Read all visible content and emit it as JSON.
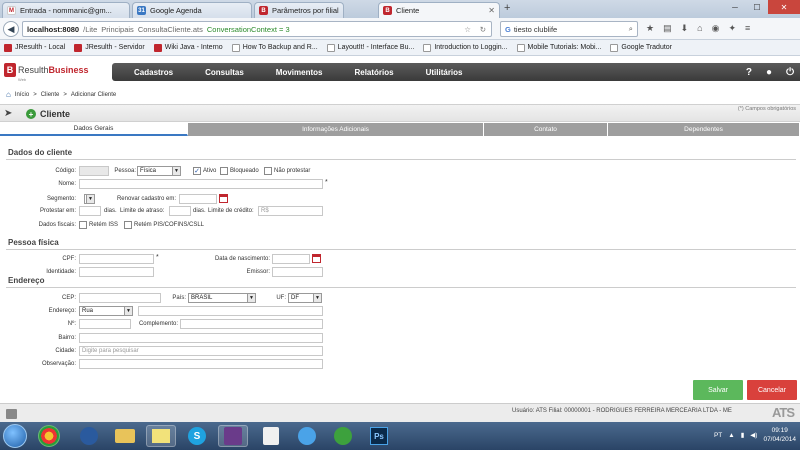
{
  "browser": {
    "tabs": [
      {
        "label": "Entrada - nommanic@gm...",
        "icon": "gmail-icon"
      },
      {
        "label": "Google Agenda",
        "icon": "calendar-icon"
      },
      {
        "label": "Parâmetros por filial",
        "icon": "resulth-icon"
      },
      {
        "label": "Cliente",
        "icon": "resulth-icon"
      }
    ],
    "url": {
      "host": "localhost:8080",
      "crumbs": [
        "/Lite",
        "Principais",
        "ConsultaCliente.ats"
      ],
      "conversation": "ConversationContext = 3"
    },
    "search": {
      "engine": "G",
      "value": "tiesto clublife"
    },
    "bookmarks": [
      {
        "label": "JResulth - Local",
        "icon": "red"
      },
      {
        "label": "JResulth - Servidor",
        "icon": "red"
      },
      {
        "label": "Wiki Java - Interno",
        "icon": "red"
      },
      {
        "label": "How To Backup and R...",
        "icon": "plain"
      },
      {
        "label": "LayoutIt! - Interface Bu...",
        "icon": "plain"
      },
      {
        "label": "Introduction to Loggin...",
        "icon": "plain"
      },
      {
        "label": "Mobile Tutorials: Mobi...",
        "icon": "plain"
      },
      {
        "label": "Google Tradutor",
        "icon": "plain"
      }
    ]
  },
  "app": {
    "logo_main": "Resulth",
    "logo_accent": "Business",
    "logo_sub": "Web",
    "menu": [
      "Cadastros",
      "Consultas",
      "Movimentos",
      "Relatórios",
      "Utilitários"
    ],
    "header_icons": [
      "help-icon",
      "user-icon",
      "power-icon"
    ]
  },
  "breadcrumb": [
    "Início",
    ">",
    "Cliente",
    ">",
    "Adicionar Cliente"
  ],
  "title": "Cliente",
  "required_note": "(*) Campos obrigatórios",
  "tabs": [
    "Dados Gerais",
    "Informações Adicionais",
    "Contato",
    "Dependentes"
  ],
  "dados_cliente": {
    "section": "Dados do cliente",
    "codigo_label": "Código:",
    "pessoa_label": "Pessoa:",
    "pessoa_value": "Física",
    "ativo_label": "Ativo",
    "bloqueado_label": "Bloqueado",
    "nao_protestar_label": "Não protestar",
    "nome_label": "Nome:",
    "segmento_label": "Segmento:",
    "renovar_label": "Renovar cadastro em:",
    "protestar_label": "Protestar em:",
    "dias1": "dias.",
    "limite_atraso_label": "Limite de atraso:",
    "dias2": "dias.",
    "limite_credito_label": "Limite de crédito:",
    "limite_credito_value": "R$",
    "dados_fiscais_label": "Dados fiscais:",
    "retem_iss_label": "Retém ISS",
    "retem_pis_label": "Retém PIS/COFINS/CSLL",
    "asterisk": "*"
  },
  "pessoa_fisica": {
    "section": "Pessoa física",
    "cpf_label": "CPF:",
    "nascimento_label": "Data de nascimento:",
    "identidade_label": "Identidade:",
    "emissor_label": "Emissor:"
  },
  "endereco": {
    "section": "Endereço",
    "cep_label": "CEP:",
    "pais_label": "País:",
    "pais_value": "BRASIL",
    "uf_label": "UF:",
    "uf_value": "DF",
    "endereco_label": "Endereço:",
    "endereco_tipo": "Rua",
    "numero_label": "Nº:",
    "complemento_label": "Complemento:",
    "bairro_label": "Bairro:",
    "cidade_label": "Cidade:",
    "cidade_placeholder": "Digite para pesquisar",
    "observacao_label": "Observação:"
  },
  "actions": {
    "save": "Salvar",
    "cancel": "Cancelar"
  },
  "footer": {
    "usuario_label": "Usuário:",
    "usuario_value": "ATS",
    "filial_label": "Filial:",
    "filial_value": "00000001 - RODRIGUES FERREIRA MERCEARIA LTDA - ME",
    "brand": "ATS"
  },
  "taskbar": {
    "lang": "PT",
    "time": "09:19",
    "date": "07/04/2014"
  },
  "colors": {
    "brand_red": "#c0262e",
    "save_green": "#5cb85c",
    "cancel_red": "#d9413c",
    "menubar": "#454545",
    "tab_inactive": "#9e9e9e"
  }
}
